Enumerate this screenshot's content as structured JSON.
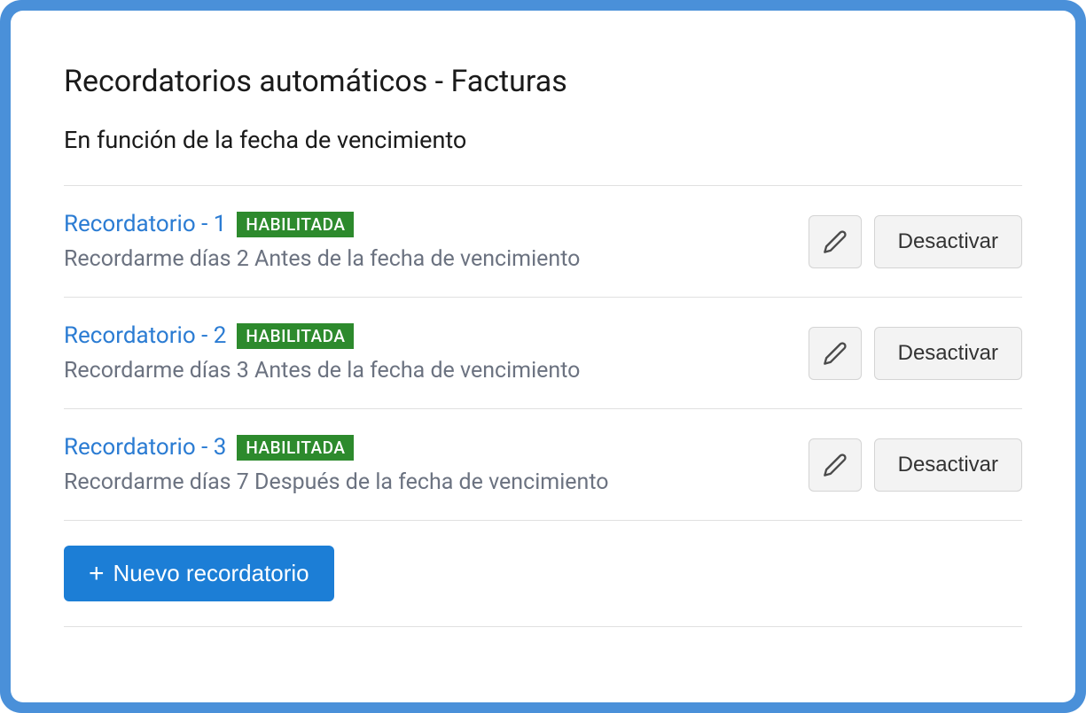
{
  "page": {
    "title": "Recordatorios automáticos - Facturas",
    "subtitle": "En función de la fecha de vencimiento"
  },
  "reminders": [
    {
      "name": "Recordatorio - 1",
      "status": "HABILITADA",
      "description": "Recordarme días 2 Antes de la fecha de vencimiento",
      "action_label": "Desactivar"
    },
    {
      "name": "Recordatorio - 2",
      "status": "HABILITADA",
      "description": "Recordarme días 3 Antes de la fecha de vencimiento",
      "action_label": "Desactivar"
    },
    {
      "name": "Recordatorio - 3",
      "status": "HABILITADA",
      "description": "Recordarme días 7 Después de la fecha de vencimiento",
      "action_label": "Desactivar"
    }
  ],
  "buttons": {
    "add_reminder": "Nuevo recordatorio"
  },
  "icons": {
    "edit": "pencil-icon",
    "plus": "+"
  },
  "colors": {
    "frame": "#4a90d9",
    "link": "#2b7cd3",
    "badge_bg": "#2d8a2d",
    "primary_button": "#1c7ed6"
  }
}
